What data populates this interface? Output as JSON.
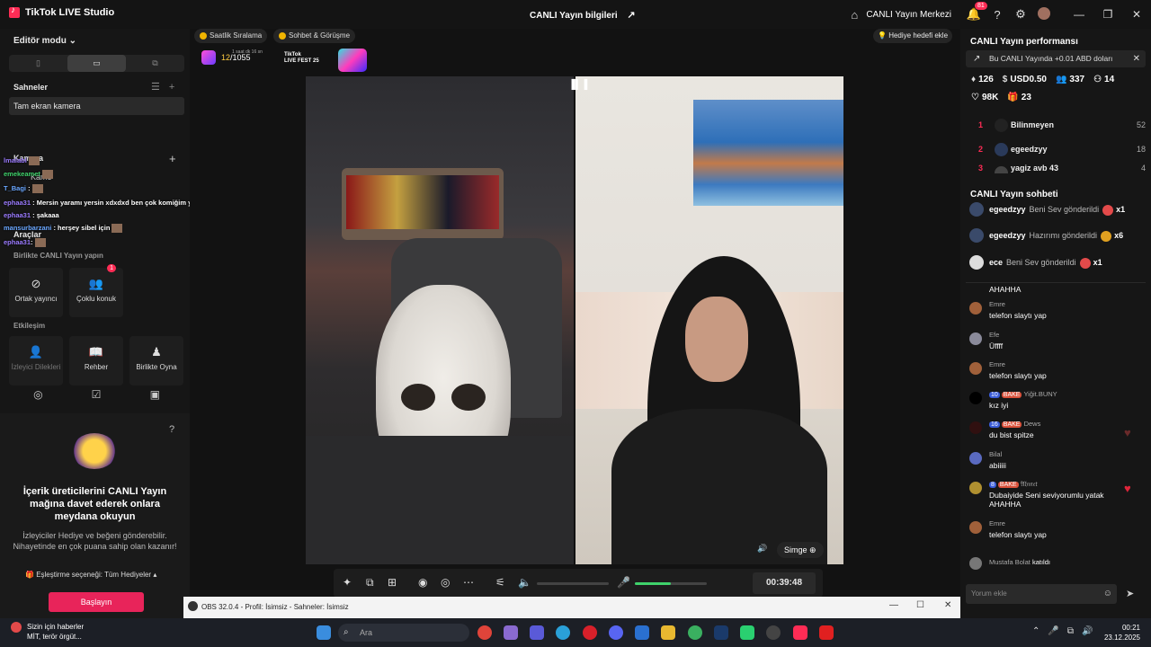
{
  "titlebar": {
    "app_name": "TikTok LIVE Studio",
    "center_title": "CANLI Yayın bilgileri",
    "center_link": "CANLI Yayın Merkezi",
    "notification_count": "81"
  },
  "left": {
    "editor_mode": "Editör modu",
    "scenes_title": "Sahneler",
    "scene_item": "Tam ekran kamera",
    "camera_title": "Kamera",
    "camera_item": "Kame",
    "tools_title": "Araçlar",
    "together_title": "Birlikte CANLI Yayın yapın",
    "tools_row1": [
      {
        "label": "Ortak yayıncı",
        "icon": "link-icon"
      },
      {
        "label": "Çoklu konuk",
        "icon": "users-icon",
        "badge": "1"
      }
    ],
    "interaction_title": "Etkileşim",
    "tools_row2": [
      {
        "label": "İzleyici Dilekleri",
        "icon": "user-icon"
      },
      {
        "label": "Rehber",
        "icon": "book-icon"
      },
      {
        "label": "Birlikte Oyna",
        "icon": "person-icon"
      }
    ],
    "overlay_chat": [
      {
        "user": "lmalabl",
        "text": ""
      },
      {
        "user": "emekeamet",
        "text": ""
      },
      {
        "user": "T_Bagi",
        "text": ":"
      },
      {
        "user": "ephaa31",
        "text": ": Mersin yaramı yersin xdxdxd ben çok komiğim yav"
      },
      {
        "user": "ephaa31",
        "text": ": şakaaa"
      },
      {
        "user": "mansurbarzani",
        "text": ": herşey sibel için"
      },
      {
        "user": "ephaa31",
        "text": ":"
      }
    ],
    "invite": {
      "title": "İçerik üreticilerini CANLI Yayın mağına davet ederek onlara meydana okuyun",
      "desc": "İzleyiciler Hediye ve beğeni gönderebilir. Nihayetinde en çok puana sahip olan kazanır!",
      "option": "Eşleştirme seçeneği: Tüm Hediyeler",
      "start_button": "Başlayın"
    }
  },
  "center": {
    "chip_hourly": "Saatlik Sıralama",
    "chip_chat": "Sohbet & Görüşme",
    "goal_button": "Hediye hedefi ekle",
    "fest_count": "12",
    "fest_total": "/1055",
    "fest_small": "1 saat dk 16 sn",
    "fest_logo_1": "TikTok",
    "fest_logo_2": "LIVE FEST 25",
    "simge_button": "Simge",
    "timer": "00:39:48",
    "volume_level": 0.5
  },
  "obs": {
    "title": "OBS 32.0.4 - Profil: İsimsiz - Sahneler: İsimsiz"
  },
  "right": {
    "perf_title": "CANLI Yayın performansı",
    "earn_text": "Bu CANLI Yayında +0.01 ABD doları",
    "stats1": [
      "126",
      "USD0.50",
      "337",
      "14"
    ],
    "stats2": [
      "98K",
      "23"
    ],
    "ranking": [
      {
        "rank": "1",
        "name": "Bilinmeyen",
        "score": "52"
      },
      {
        "rank": "2",
        "name": "egeedzyy",
        "score": "18"
      },
      {
        "rank": "3",
        "name": "yagiz avb 43",
        "score": "4"
      }
    ],
    "chat_title": "CANLI Yayın sohbeti",
    "gifts": [
      {
        "name": "egeedzyy",
        "text": "Beni Sev gönderildi",
        "mult": "x1"
      },
      {
        "name": "egeedzyy",
        "text": "Hazırımı gönderildi",
        "mult": "x6"
      },
      {
        "name": "ece",
        "text": "Beni Sev gönderildi",
        "mult": "x1"
      }
    ],
    "messages": [
      {
        "user": "",
        "text": "AHAHHA"
      },
      {
        "user": "Emre",
        "text": "telefon slaytı yap"
      },
      {
        "user": "Efe",
        "text": "Üffff"
      },
      {
        "user": "Emre",
        "text": "telefon slaytı yap"
      },
      {
        "user": "Yiğit.BUNY",
        "text": "kız iyi",
        "level": "10",
        "badge": "BAKE"
      },
      {
        "user": "Dews",
        "text": "du bist spitze",
        "level": "16",
        "badge": "BAKE"
      },
      {
        "user": "Bilal",
        "text": "abiiiii"
      },
      {
        "user": "𝔄𝔥𝔪𝔢𝔱",
        "text": "Dubaiyide Seni seviyorumlu yatak AHAHHA",
        "level": "8",
        "badge": "BAKE"
      },
      {
        "user": "Emre",
        "text": "telefon slaytı yap"
      },
      {
        "user": "Mustafa Bolat",
        "text": "katıldı"
      }
    ],
    "comment_placeholder": "Yorum ekle"
  },
  "taskbar": {
    "news_title": "Sizin için haberler",
    "news_sub": "MİT, terör örgüt...",
    "search_placeholder": "Ara",
    "time": "00:21",
    "date": "23.12.2025"
  }
}
